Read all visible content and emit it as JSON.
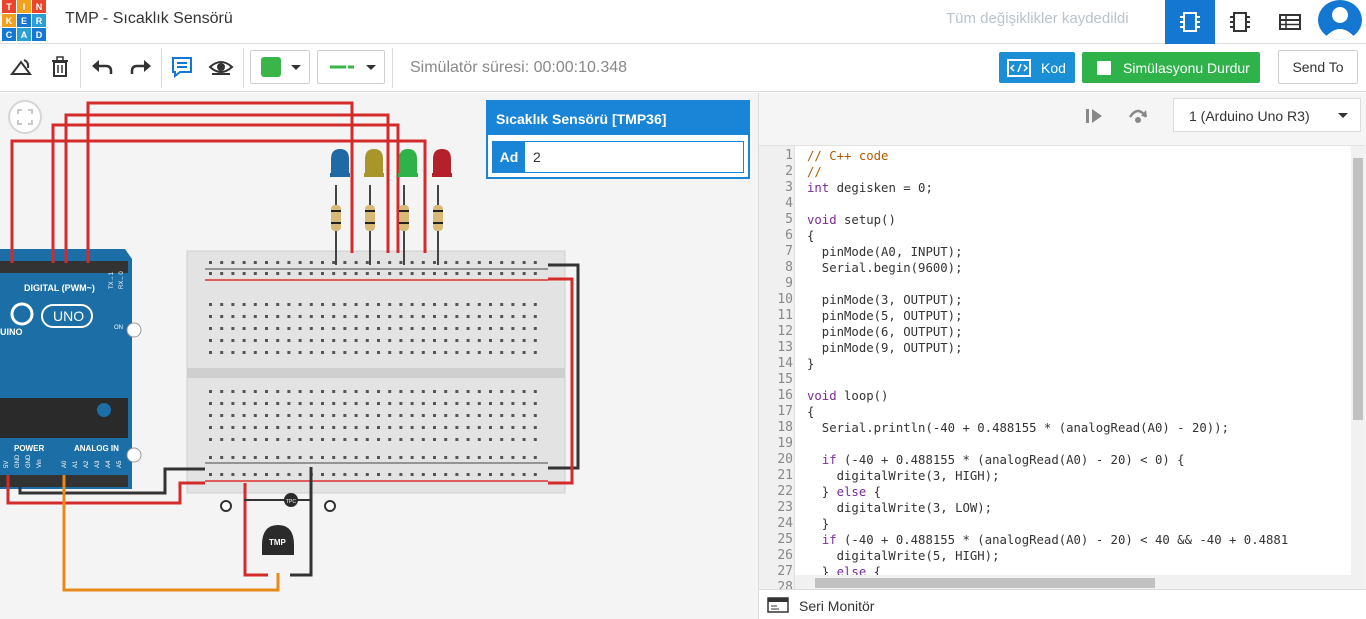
{
  "app": {
    "logo_letters": [
      "T",
      "I",
      "N",
      "K",
      "E",
      "R",
      "C",
      "A",
      "D"
    ],
    "title": "TMP - Sıcaklık Sensörü",
    "saved_status": "Tüm değişiklikler kaydedildi",
    "brand_color": "#1477d1"
  },
  "toolbar": {
    "color_swatch": "#3ab54a",
    "sim_time": "Simülatör süresi: 00:00:10.348",
    "code_label": "Kod",
    "stop_label": "Simülasyonu Durdur",
    "send_to_label": "Send To"
  },
  "panel": {
    "title": "Sıcaklık Sensörü [TMP36]",
    "field_label": "Ad",
    "field_value": "2"
  },
  "board": {
    "digital_label": "DIGITAL (PWM~)",
    "uno_label": "UNO",
    "arduino_label": "UINO",
    "on_label": "ON",
    "power_label": "POWER",
    "analog_label": "ANALOG IN",
    "tx_label": "TX→1",
    "rx_label": "RX←0",
    "tmp_label": "TMP",
    "tmp_small_label": "TPC",
    "pin_labels": [
      "5V",
      "GND",
      "GND",
      "Vin",
      "A0",
      "A1",
      "A2",
      "A3",
      "A4",
      "A5"
    ]
  },
  "code_panel": {
    "device_select": "1 (Arduino Uno R3)",
    "serial_monitor": "Seri Monitör",
    "lines": [
      "// C++ code",
      "//",
      "int degisken = 0;",
      "",
      "void setup()",
      "{",
      "  pinMode(A0, INPUT);",
      "  Serial.begin(9600);",
      "",
      "  pinMode(3, OUTPUT);",
      "  pinMode(5, OUTPUT);",
      "  pinMode(6, OUTPUT);",
      "  pinMode(9, OUTPUT);",
      "}",
      "",
      "void loop()",
      "{",
      "  Serial.println(-40 + 0.488155 * (analogRead(A0) - 20));",
      "",
      "  if (-40 + 0.488155 * (analogRead(A0) - 20) < 0) {",
      "    digitalWrite(3, HIGH);",
      "  } else {",
      "    digitalWrite(3, LOW);",
      "  }",
      "  if (-40 + 0.488155 * (analogRead(A0) - 20) < 40 && -40 + 0.4881",
      "    digitalWrite(5, HIGH);",
      "  } else {",
      ""
    ]
  },
  "leds": [
    {
      "name": "blue",
      "color": "#1f6aa5"
    },
    {
      "name": "yellow",
      "color": "#a8962a"
    },
    {
      "name": "green",
      "color": "#2fb24a"
    },
    {
      "name": "red",
      "color": "#b5212a"
    }
  ]
}
